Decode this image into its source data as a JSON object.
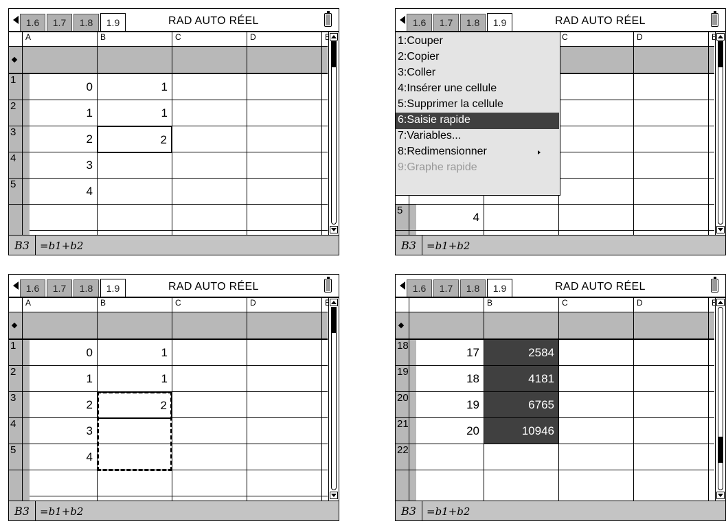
{
  "tabs": [
    "1.6",
    "1.7",
    "1.8",
    "1.9"
  ],
  "status": "RAD AUTO RÉEL",
  "columns": [
    "A",
    "B",
    "C",
    "D",
    "E"
  ],
  "entry": {
    "ref": "B3",
    "formula": "=b1+b2"
  },
  "panel1": {
    "rows": [
      {
        "label": "1",
        "a": "0",
        "b": "1"
      },
      {
        "label": "2",
        "a": "1",
        "b": "1"
      },
      {
        "label": "3",
        "a": "2",
        "b": "2"
      },
      {
        "label": "4",
        "a": "3",
        "b": ""
      },
      {
        "label": "5",
        "a": "4",
        "b": ""
      }
    ]
  },
  "panel2": {
    "menu": [
      "1:Couper",
      "2:Copier",
      "3:Coller",
      "4:Insérer une cellule",
      "5:Supprimer la cellule",
      "6:Saisie rapide",
      "7:Variables...",
      "8:Redimensionner",
      "9:Graphe rapide"
    ],
    "visible_row": {
      "label": "5",
      "a": "4"
    }
  },
  "panel3": {
    "rows": [
      {
        "label": "1",
        "a": "0",
        "b": "1"
      },
      {
        "label": "2",
        "a": "1",
        "b": "1"
      },
      {
        "label": "3",
        "a": "2",
        "b": "2"
      },
      {
        "label": "4",
        "a": "3",
        "b": ""
      },
      {
        "label": "5",
        "a": "4",
        "b": ""
      }
    ]
  },
  "panel4": {
    "rows": [
      {
        "label": "18",
        "a": "17",
        "b": "2584"
      },
      {
        "label": "19",
        "a": "18",
        "b": "4181"
      },
      {
        "label": "20",
        "a": "19",
        "b": "6765"
      },
      {
        "label": "21",
        "a": "20",
        "b": "10946"
      },
      {
        "label": "22",
        "a": "",
        "b": ""
      }
    ]
  }
}
